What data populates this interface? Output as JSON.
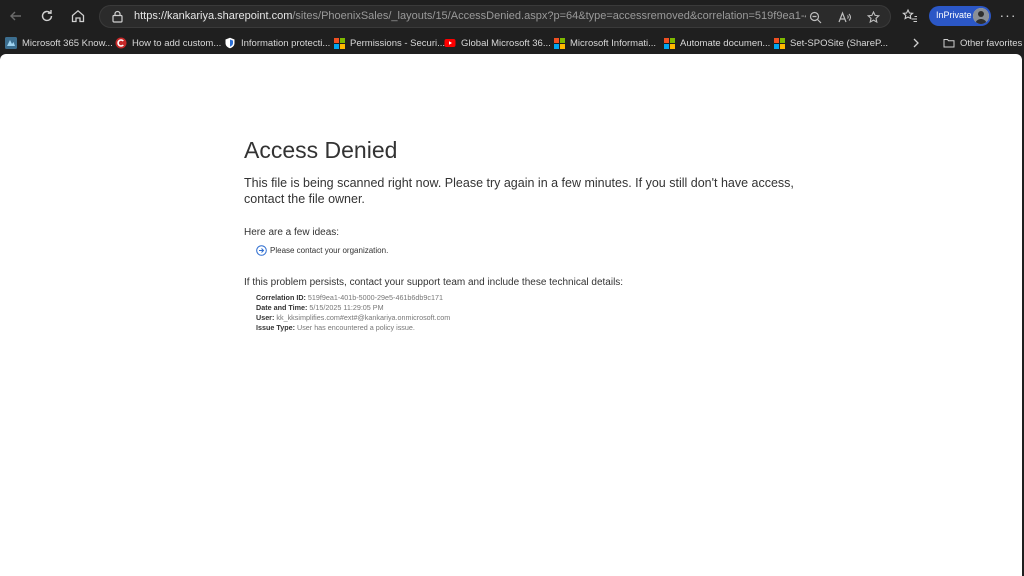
{
  "browser": {
    "url_host": "https://kankariya.sharepoint.com",
    "url_path": "/sites/PhoenixSales/_layouts/15/AccessDenied.aspx?p=64&type=accessremoved&correlation=519f9ea1-401b-5000...",
    "inprivate_label": "InPrivate",
    "more_label": "···",
    "bookmarks": [
      {
        "label": "Microsoft 365 Know...",
        "icon": "m365-knowledge-icon"
      },
      {
        "label": "How to add custom...",
        "icon": "red-c-logo-icon"
      },
      {
        "label": "Information protecti...",
        "icon": "shield-icon"
      },
      {
        "label": "Permissions - Securi...",
        "icon": "microsoft-logo-icon"
      },
      {
        "label": "Global Microsoft 36...",
        "icon": "youtube-icon"
      },
      {
        "label": "Microsoft Informati...",
        "icon": "microsoft-logo-icon"
      },
      {
        "label": "Automate documen...",
        "icon": "microsoft-logo-icon"
      },
      {
        "label": "Set-SPOSite (ShareP...",
        "icon": "microsoft-logo-icon"
      }
    ],
    "other_favorites": "Other favorites"
  },
  "page": {
    "title": "Access Denied",
    "message": "This file is being scanned right now. Please try again in a few minutes. If you still don't have access, contact the file owner.",
    "ideas_title": "Here are a few ideas:",
    "idea": "Please contact your organization.",
    "persist_text": "If this problem persists, contact your support team and include these technical details:",
    "details": {
      "correlation_label": "Correlation ID:",
      "correlation_value": "519f9ea1-401b-5000-29e5-461b6db9c171",
      "datetime_label": "Date and Time:",
      "datetime_value": "5/15/2025 11:29:05 PM",
      "user_label": "User:",
      "user_value": "kk_kksimplifies.com#ext#@kankariya.onmicrosoft.com",
      "issue_label": "Issue Type:",
      "issue_value": "User has encountered a policy issue."
    }
  },
  "colors": {
    "chrome_bg": "#1f1f1f",
    "inprivate_blue": "#2b57c6",
    "page_text": "#333333",
    "detail_text": "#777777",
    "idea_icon": "#2f6ed0"
  }
}
